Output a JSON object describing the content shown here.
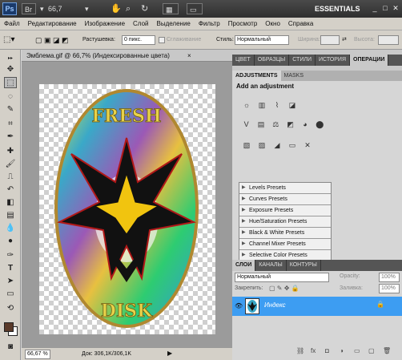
{
  "app": {
    "logo": "Ps",
    "zoom_value": "66,7",
    "workspace": "ESSENTIALS",
    "win_minimize": "_",
    "win_maximize": "□",
    "win_close": "✕"
  },
  "menu": [
    "Файл",
    "Редактирование",
    "Изображение",
    "Слой",
    "Выделение",
    "Фильтр",
    "Просмотр",
    "Окно",
    "Справка"
  ],
  "options": {
    "feather_label": "Растушевка:",
    "feather_value": "0 пикс.",
    "antialias_label": "Сглаживание",
    "style_label": "Стиль:",
    "style_value": "Нормальный",
    "width_label": "Ширина:",
    "height_label": "Высота:"
  },
  "document": {
    "tab_title": "Эмблема.gif @ 66,7% (Индексированные цвета)",
    "close_glyph": "×",
    "status_zoom": "66,67 %",
    "doc_info": "Док: 306,1K/306,1K",
    "artwork_top_text": "FRESH",
    "artwork_bottom_text": "DISK"
  },
  "panels": {
    "top_tabs": [
      "ЦВЕТ",
      "ОБРАЗЦЫ",
      "СТИЛИ",
      "ИСТОРИЯ",
      "ОПЕРАЦИИ"
    ],
    "adj_tabs": [
      "ADJUSTMENTS",
      "MASKS"
    ],
    "adj_title": "Add an adjustment",
    "presets": [
      "Levels Presets",
      "Curves Presets",
      "Exposure Presets",
      "Hue/Saturation Presets",
      "Black & White Presets",
      "Channel Mixer Presets",
      "Selective Color Presets"
    ],
    "layers_tabs": [
      "СЛОИ",
      "КАНАЛЫ",
      "КОНТУРЫ"
    ],
    "blend_mode": "Нормальный",
    "opacity_label": "Opacity:",
    "opacity_value": "100%",
    "lock_label": "Закрепить:",
    "fill_label": "Заливка:",
    "fill_value": "100%",
    "layer_name": "Индекс"
  },
  "colors": {
    "accent": "#3d9df2",
    "foreground": "#5a3a2a",
    "background": "#ffffff"
  }
}
